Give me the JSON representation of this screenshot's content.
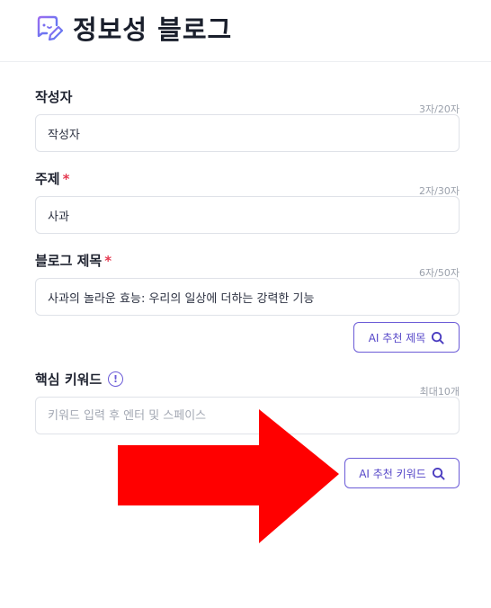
{
  "header": {
    "title": "정보성 블로그"
  },
  "form": {
    "author": {
      "label": "작성자",
      "counter": "3자/20자",
      "value": "작성자"
    },
    "topic": {
      "label": "주제",
      "required_mark": "*",
      "counter": "2자/30자",
      "value": "사과"
    },
    "blog_title": {
      "label": "블로그 제목",
      "required_mark": "*",
      "counter": "6자/50자",
      "value": "사과의 놀라운 효능: 우리의 일상에 더하는 강력한 기능"
    },
    "ai_title_button": "AI 추천 제목",
    "keywords": {
      "label": "핵심 키워드",
      "info_icon": "!",
      "counter": "최대10개",
      "placeholder": "키워드 입력 후 엔터 및 스페이스"
    },
    "ai_keyword_button": "AI 추천 키워드"
  },
  "colors": {
    "accent": "#6b5bd7",
    "required": "#e53950",
    "arrow": "#ff0000"
  },
  "icons": {
    "logo": "edit-chat-icon",
    "search": "search-icon",
    "info": "info-icon"
  }
}
